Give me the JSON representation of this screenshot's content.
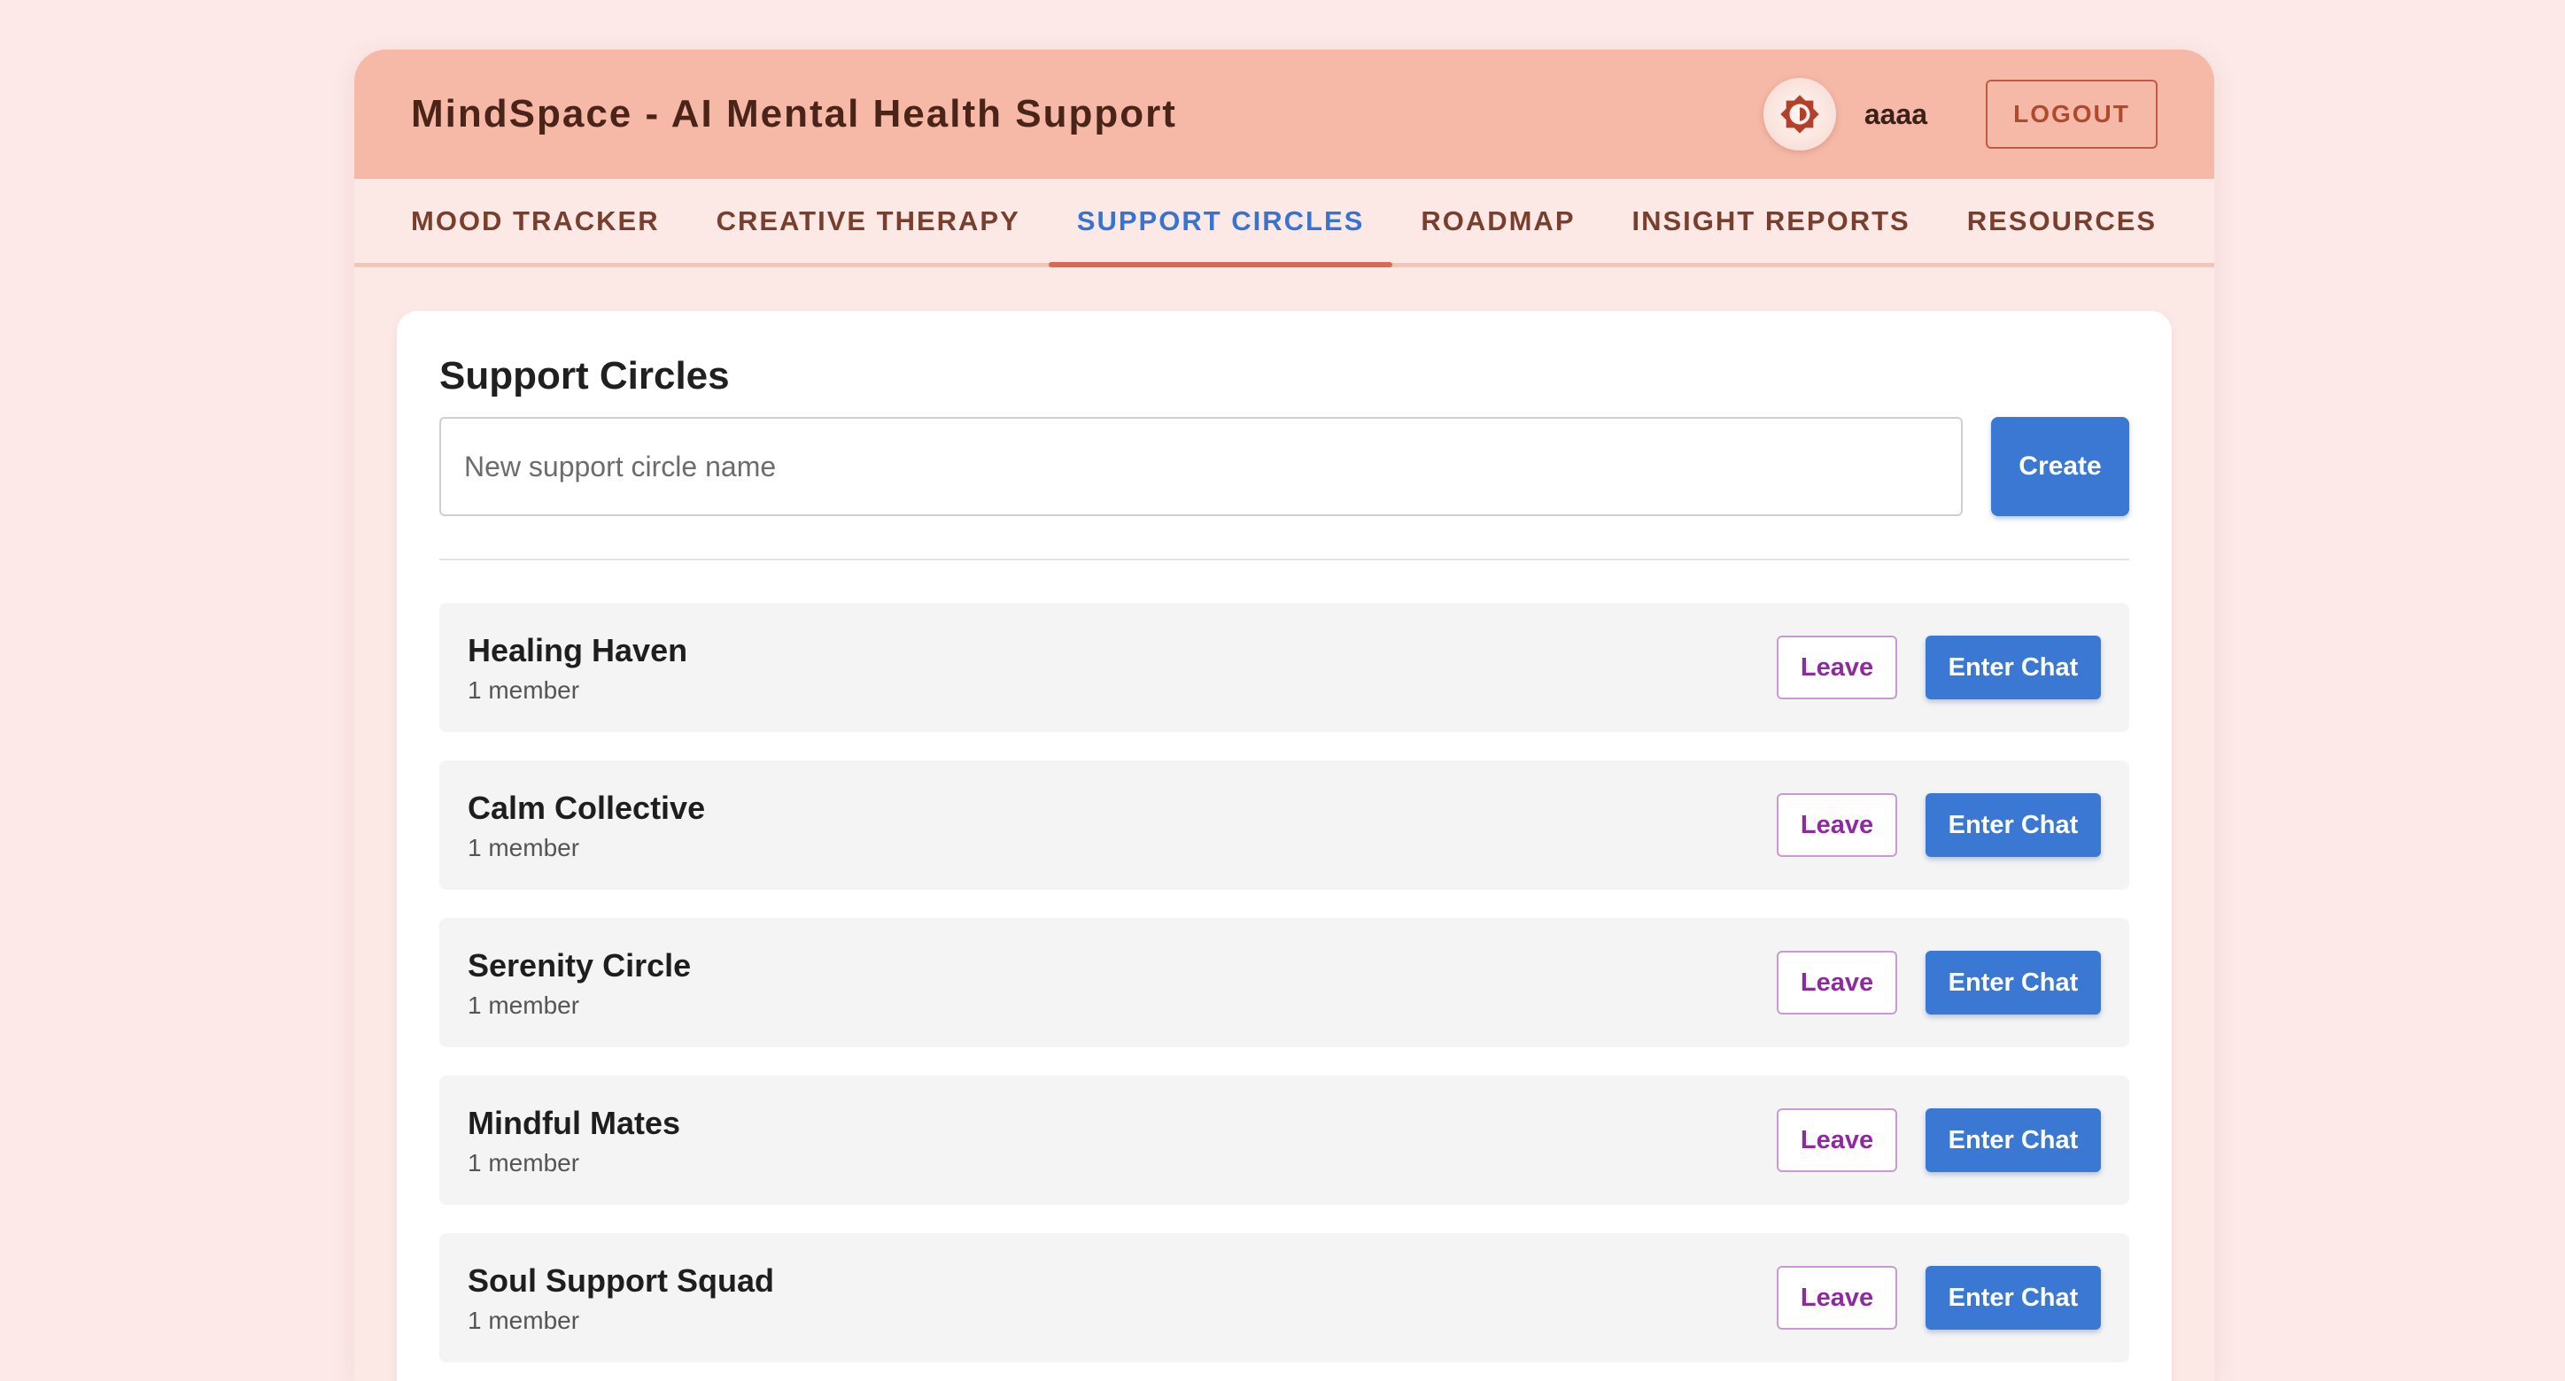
{
  "header": {
    "title": "MindSpace - AI Mental Health Support",
    "theme_icon": "brightness-icon",
    "username": "aaaa",
    "logout_label": "LOGOUT"
  },
  "tabs": [
    {
      "label": "MOOD TRACKER",
      "active": false
    },
    {
      "label": "CREATIVE THERAPY",
      "active": false
    },
    {
      "label": "SUPPORT CIRCLES",
      "active": true
    },
    {
      "label": "ROADMAP",
      "active": false
    },
    {
      "label": "INSIGHT REPORTS",
      "active": false
    },
    {
      "label": "RESOURCES",
      "active": false
    }
  ],
  "support": {
    "title": "Support Circles",
    "input_placeholder": "New support circle name",
    "input_value": "",
    "create_label": "Create",
    "circles": [
      {
        "name": "Healing Haven",
        "members": "1 member",
        "leave_label": "Leave",
        "enter_label": "Enter Chat"
      },
      {
        "name": "Calm Collective",
        "members": "1 member",
        "leave_label": "Leave",
        "enter_label": "Enter Chat"
      },
      {
        "name": "Serenity Circle",
        "members": "1 member",
        "leave_label": "Leave",
        "enter_label": "Enter Chat"
      },
      {
        "name": "Mindful Mates",
        "members": "1 member",
        "leave_label": "Leave",
        "enter_label": "Enter Chat"
      },
      {
        "name": "Soul Support Squad",
        "members": "1 member",
        "leave_label": "Leave",
        "enter_label": "Enter Chat"
      }
    ]
  },
  "colors": {
    "header_bg": "#f6b9a8",
    "page_bg": "#fce9e8",
    "primary": "#3a78d4",
    "active_tab": "#3774d1",
    "tab_indicator": "#d86a55",
    "leave": "#8e2aa0"
  }
}
